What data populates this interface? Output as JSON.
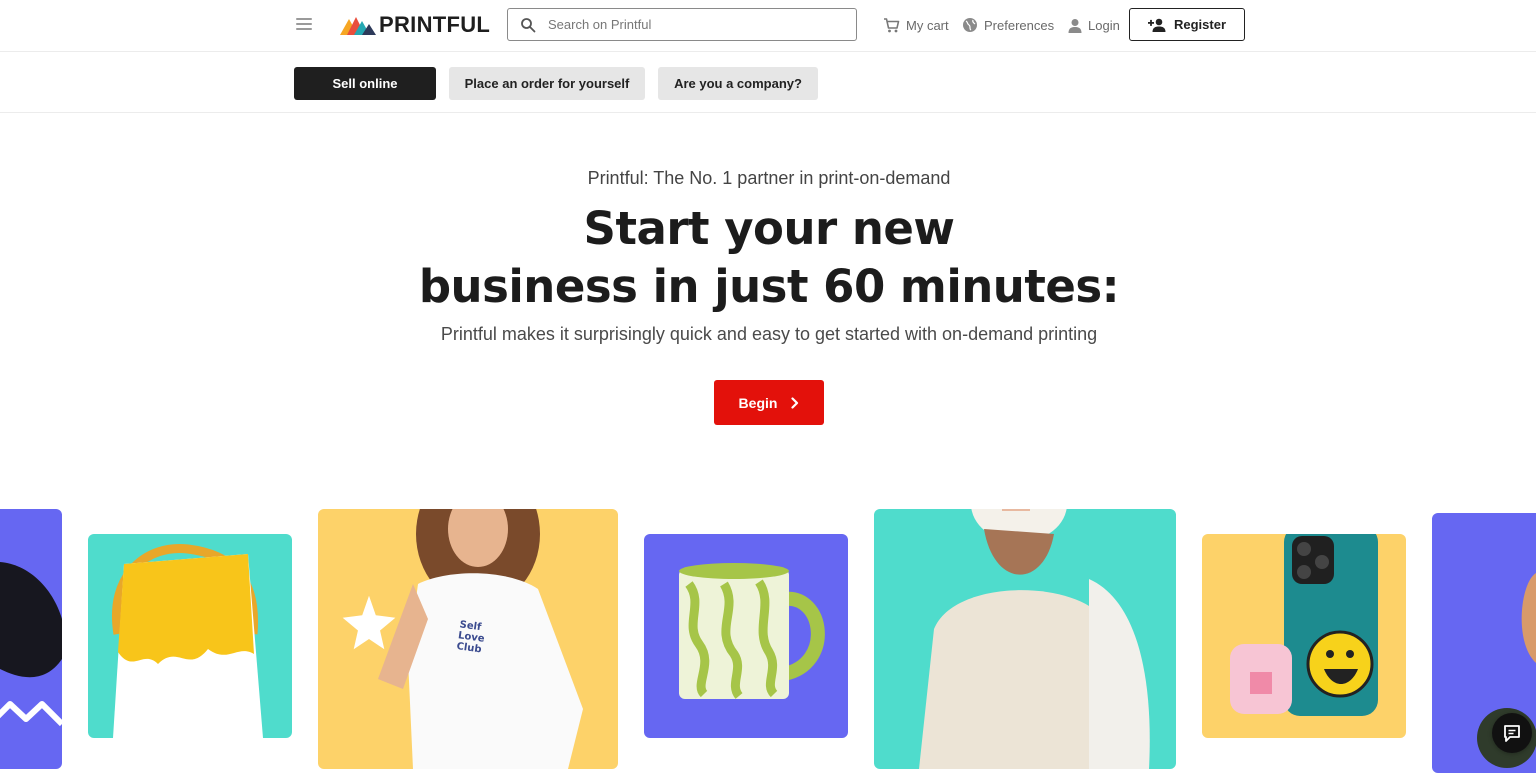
{
  "header": {
    "logo_text": "PRINTFUL",
    "search": {
      "placeholder": "Search on Printful",
      "value": ""
    },
    "cart_label": "My cart",
    "preferences_label": "Preferences",
    "login_label": "Login",
    "register_label": "Register"
  },
  "subnav": {
    "sell_online": "Sell online",
    "place_order": "Place an order for yourself",
    "company": "Are you a company?"
  },
  "hero": {
    "eyebrow": "Printful: The No. 1 partner in print-on-demand",
    "headline_line1": "Start your new",
    "headline_line2": "business in just 60 minutes:",
    "subline": "Printful makes it surprisingly quick and easy to get started with on-demand printing",
    "cta_label": "Begin"
  },
  "products": {
    "tshirt_print_text": [
      "Self",
      "Love",
      "Club"
    ]
  },
  "colors": {
    "brand_red": "#e3110b",
    "dark": "#1f1f1f",
    "purple": "#6667f2",
    "teal": "#4fdccc",
    "yellow": "#fdd269"
  },
  "icons": [
    "menu-icon",
    "search-icon",
    "cart-icon",
    "globe-icon",
    "user-icon",
    "add-user-icon",
    "chevron-right-icon",
    "chat-icon"
  ]
}
